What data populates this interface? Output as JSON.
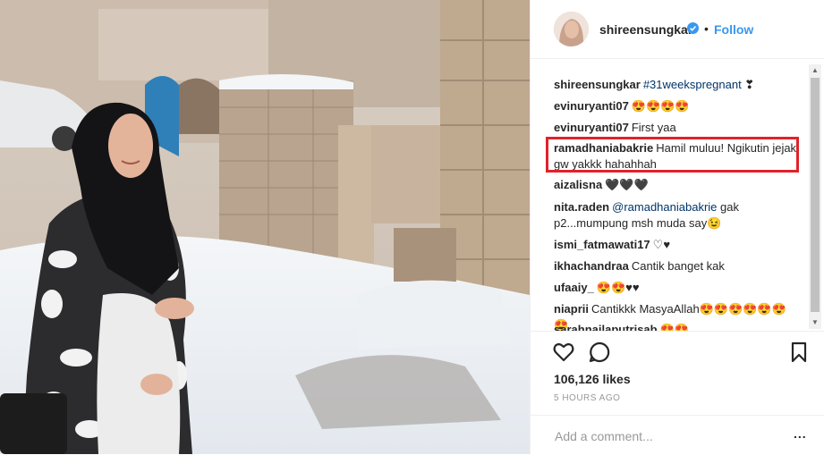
{
  "post": {
    "author": "shireensungkar",
    "follow_label": "Follow",
    "separator": "•",
    "likes": "106,126 likes",
    "time": "5 HOURS AGO",
    "add_comment_placeholder": "Add a comment...",
    "more_label": "..."
  },
  "comments": [
    {
      "user": "shireensungkar",
      "text": "",
      "tag": "#31weekspregnant",
      "after": " ❣"
    },
    {
      "user": "evinuryanti07",
      "text": "😍😍😍😍"
    },
    {
      "user": "evinuryanti07",
      "text": "First yaa"
    },
    {
      "user": "ramadhaniabakrie",
      "text": "Hamil muluu! Ngikutin jejak gw yakkk hahahhah"
    },
    {
      "user": "aizalisna",
      "text": "🖤🖤🖤"
    },
    {
      "user": "nita.raden",
      "mention": "@ramadhaniabakrie",
      "text": " gak p2...mumpung msh muda say😉"
    },
    {
      "user": "ismi_fatmawati17",
      "text": "♡♥"
    },
    {
      "user": "ikhachandraa",
      "text": "Cantik banget kak"
    },
    {
      "user": "ufaaiy_",
      "text": "😍😍♥♥"
    },
    {
      "user": "niaprii",
      "text": "Cantikkk MasyaAllah😍😍😍😍😍😍😍"
    },
    {
      "user": "sarahnailaputrisab",
      "text": "😍😍"
    }
  ],
  "colors": {
    "accent": "#3897f0",
    "highlight": "#e0222a",
    "link": "#003569"
  },
  "icons": [
    "heart-icon",
    "comment-icon",
    "bookmark-icon",
    "verified-badge-icon"
  ]
}
